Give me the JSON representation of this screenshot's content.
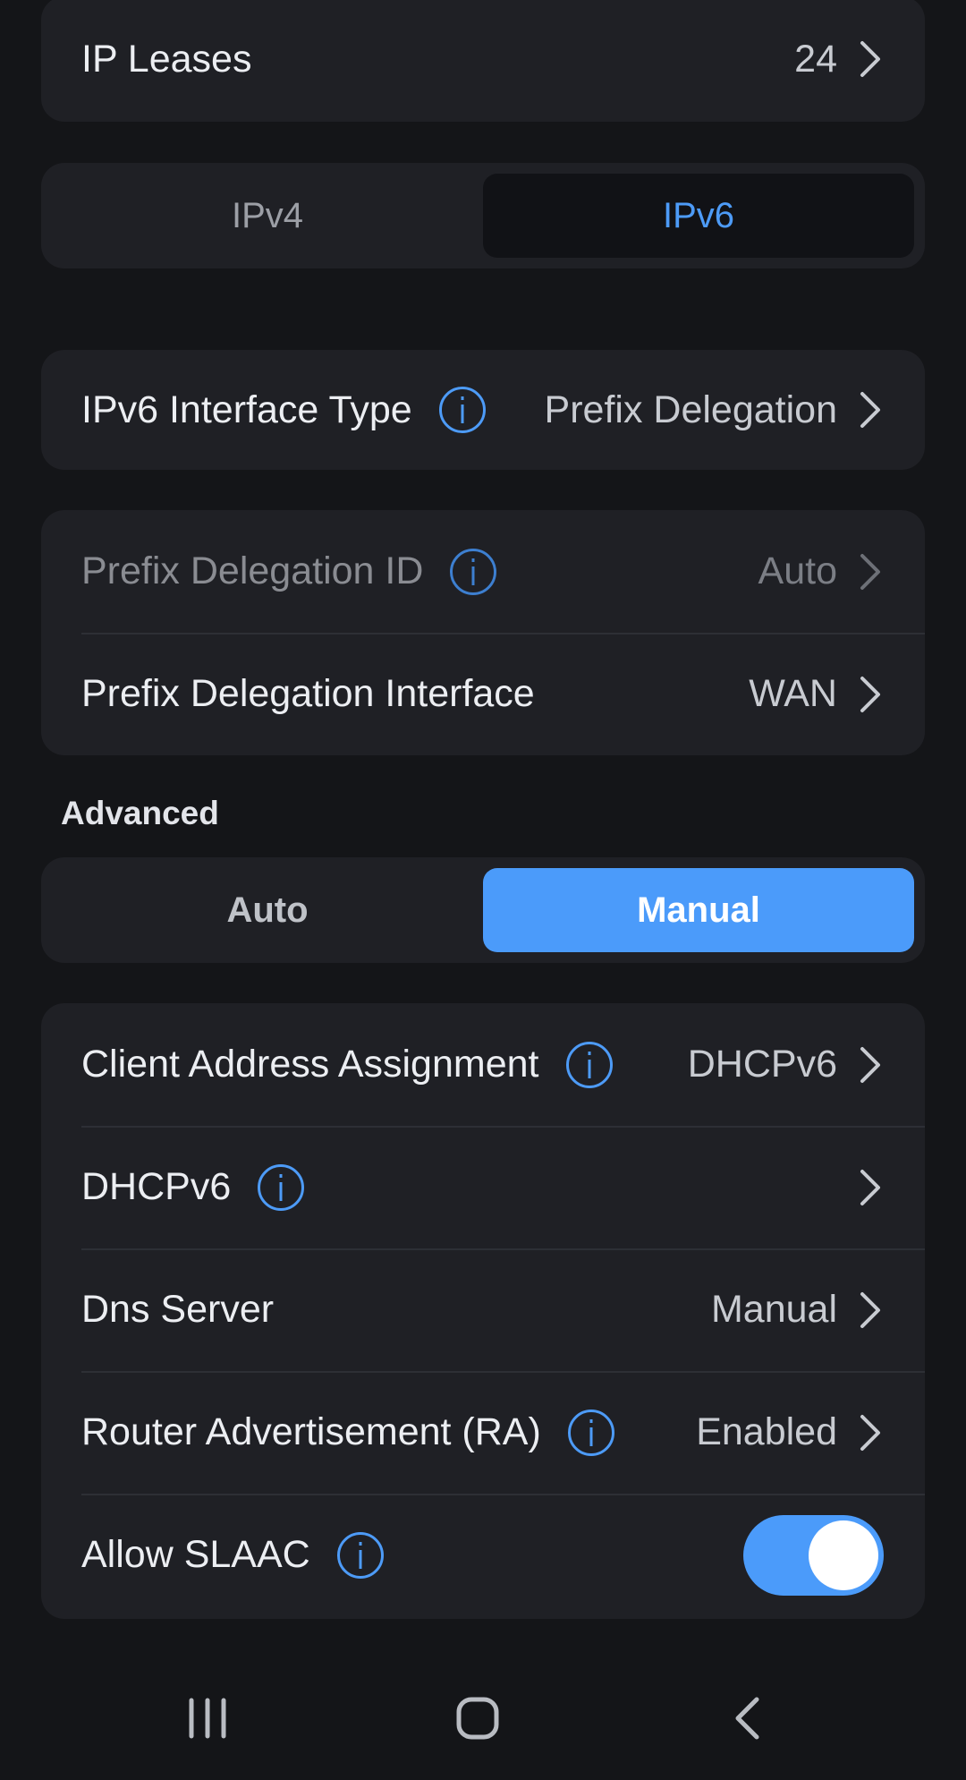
{
  "ip_leases": {
    "label": "IP Leases",
    "value": "24"
  },
  "ip_version_tabs": [
    {
      "label": "IPv4",
      "selected": false
    },
    {
      "label": "IPv6",
      "selected": true
    }
  ],
  "interface_type": {
    "label": "IPv6 Interface Type",
    "value": "Prefix Delegation"
  },
  "prefix_delegation": {
    "id": {
      "label": "Prefix Delegation ID",
      "value": "Auto",
      "disabled": true
    },
    "interface": {
      "label": "Prefix Delegation Interface",
      "value": "WAN"
    }
  },
  "advanced": {
    "title": "Advanced",
    "modes": [
      {
        "label": "Auto",
        "selected": false
      },
      {
        "label": "Manual",
        "selected": true
      }
    ],
    "rows": {
      "client_address": {
        "label": "Client Address Assignment",
        "value": "DHCPv6"
      },
      "dhcpv6": {
        "label": "DHCPv6",
        "value": ""
      },
      "dns_server": {
        "label": "Dns Server",
        "value": "Manual"
      },
      "router_advertisement": {
        "label": "Router Advertisement (RA)",
        "value": "Enabled"
      },
      "allow_slaac": {
        "label": "Allow SLAAC",
        "enabled": true
      }
    }
  },
  "colors": {
    "accent": "#4b9bfa",
    "background": "#141518",
    "card": "#1f2025"
  },
  "icons": {
    "info": "info-icon",
    "chevron": "chevron-right-icon"
  }
}
